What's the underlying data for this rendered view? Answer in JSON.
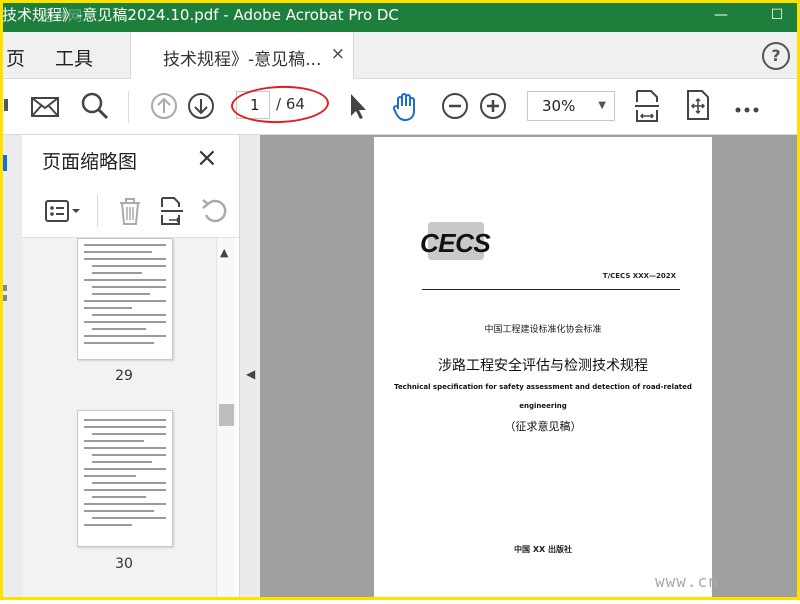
{
  "window": {
    "title": "技术规程》-意见稿2024.10.pdf - Adobe Acrobat Pro DC",
    "watermark_title": "适林网"
  },
  "nav": {
    "home_label": "页",
    "tools_label": "工具"
  },
  "tab": {
    "label": "技术规程》-意见稿...",
    "close": "×"
  },
  "help": "?",
  "toolbar": {
    "page_current": "1",
    "page_total": "/ 64",
    "zoom": "30%"
  },
  "thumbnails_pane": {
    "title": "页面缩略图",
    "close": "×",
    "pages": [
      {
        "label": "29"
      },
      {
        "label": "30"
      }
    ]
  },
  "document": {
    "logo_text": "CECS",
    "std_code": "T/CECS XXX—202X",
    "association": "中国工程建设标准化协会标准",
    "title_cn": "涉路工程安全评估与检测技术规程",
    "title_en_1": "Technical specification for safety assessment and detection of road-related",
    "title_en_2": "engineering",
    "draft_note": "（征求意见稿）",
    "publisher": "中国 XX 出版社"
  },
  "overlay_watermark": "www.cn",
  "colors": {
    "titlebar": "#1e7f3c",
    "frame": "#ffe100",
    "annotation": "#e02020",
    "viewer_bg": "#a0a0a0"
  }
}
